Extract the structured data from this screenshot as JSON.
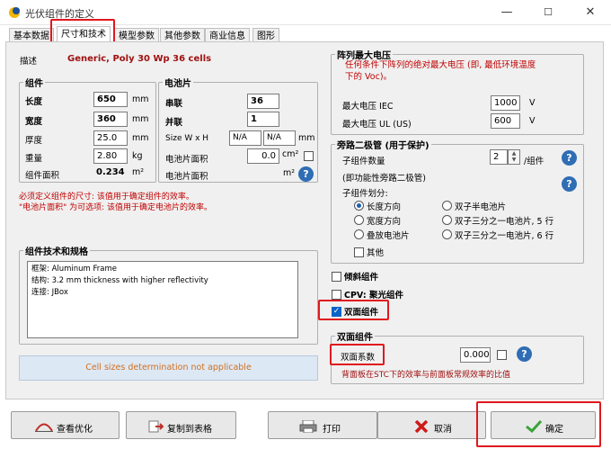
{
  "window": {
    "title": "光伏组件的定义",
    "minimize": "—",
    "maximize": "☐",
    "close": "✕"
  },
  "tabs": [
    {
      "label": "基本数据"
    },
    {
      "label": "尺寸和技术"
    },
    {
      "label": "模型参数"
    },
    {
      "label": "其他参数"
    },
    {
      "label": "商业信息"
    },
    {
      "label": "图形"
    }
  ],
  "description": {
    "label": "描述",
    "value": "Generic, Poly 30 Wp 36 cells"
  },
  "module": {
    "title": "组件",
    "length_label": "长度",
    "length_value": "650",
    "length_unit": "mm",
    "width_label": "宽度",
    "width_value": "360",
    "width_unit": "mm",
    "thickness_label": "厚度",
    "thickness_value": "25.0",
    "thickness_unit": "mm",
    "weight_label": "重量",
    "weight_value": "2.80",
    "weight_unit": "kg",
    "area_label": "组件面积",
    "area_value": "0.234",
    "area_unit": "m²"
  },
  "cells": {
    "title": "电池片",
    "series_label": "串联",
    "series_value": "36",
    "parallel_label": "并联",
    "parallel_value": "1",
    "size_label": "Size W x H",
    "size_w": "N/A",
    "size_h": "N/A",
    "size_unit": "mm",
    "cell_area_label": "电池片面积",
    "cell_area_value": "0.0",
    "cell_area_unit": "cm²",
    "cells_area_label": "电池片面积",
    "cells_area_unit": "m²"
  },
  "notes": {
    "line1": "必须定义组件的尺寸: 该值用于确定组件的效率。",
    "line2": "\"电池片面积\" 为可选项: 该值用于确定电池片的效率。"
  },
  "tech": {
    "title": "组件技术和规格",
    "line1": "框架: Aluminum Frame",
    "line2": "结构: 3.2 mm thickness with higher reflectivity",
    "line3": "连接: JBox"
  },
  "cell_size_note": "Cell sizes determination not applicable",
  "max_voltage": {
    "title": "阵列最大电压",
    "desc": "任何条件下阵列的绝对最大电压 (即, 最低环境温度下的 Voc)。",
    "iec_label": "最大电压 IEC",
    "iec_value": "1000",
    "iec_unit": "V",
    "ul_label": "最大电压 UL (US)",
    "ul_value": "600",
    "ul_unit": "V"
  },
  "bypass": {
    "title": "旁路二极管 (用于保护)",
    "count_label": "子组件数量",
    "count_value": "2",
    "count_unit": "/组件",
    "bypass_note": "(即功能性旁路二极管)",
    "division_label": "子组件划分:",
    "opt_length": "长度方向",
    "opt_width": "宽度方向",
    "opt_stack": "叠放电池片",
    "opt_half": "双子半电池片",
    "opt_third5": "双子三分之一电池片, 5 行",
    "opt_third6": "双子三分之一电池片, 6 行",
    "opt_other": "其他"
  },
  "options": {
    "tilted_label": "倾斜组件",
    "cpv_label": "CPV: 聚光组件",
    "bifacial_label": "双面组件",
    "bifacial_checked": true
  },
  "bifacial": {
    "title": "双面组件",
    "factor_label": "双面系数",
    "factor_value": "0.000",
    "desc": "背面板在STC下的效率与前面板常规效率的比值"
  },
  "buttons": {
    "optimize": "查看优化",
    "copy": "复制到表格",
    "print": "打印",
    "cancel": "取消",
    "ok": "确定"
  },
  "colors": {
    "highlight": "#e0181e",
    "accent": "#2f6db5",
    "warning_text": "#c00000"
  }
}
